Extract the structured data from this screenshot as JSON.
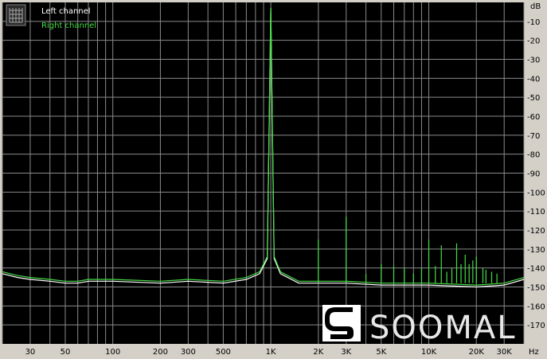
{
  "chart_data": {
    "type": "line",
    "title": "",
    "xlabel": "",
    "ylabel": "",
    "x_unit": "Hz",
    "y_unit": "dB",
    "x_scale": "log",
    "xlim": [
      20,
      40000
    ],
    "ylim": [
      -180,
      0
    ],
    "grid": true,
    "legend_placement": "top-left",
    "x_ticks": [
      {
        "value": 30,
        "label": "30"
      },
      {
        "value": 50,
        "label": "50"
      },
      {
        "value": 100,
        "label": "100"
      },
      {
        "value": 200,
        "label": "200"
      },
      {
        "value": 300,
        "label": "300"
      },
      {
        "value": 500,
        "label": "500"
      },
      {
        "value": 1000,
        "label": "1K"
      },
      {
        "value": 2000,
        "label": "2K"
      },
      {
        "value": 3000,
        "label": "3K"
      },
      {
        "value": 5000,
        "label": "5K"
      },
      {
        "value": 10000,
        "label": "10K"
      },
      {
        "value": 20000,
        "label": "20K"
      },
      {
        "value": 30000,
        "label": "30K"
      }
    ],
    "y_ticks": [
      -10,
      -20,
      -30,
      -40,
      -50,
      -60,
      -70,
      -80,
      -90,
      -100,
      -110,
      -120,
      -130,
      -140,
      -150,
      -160,
      -170
    ],
    "series": [
      {
        "name": "Left channel",
        "color": "#ffffff",
        "points": [
          [
            20,
            -143
          ],
          [
            25,
            -145
          ],
          [
            30,
            -146
          ],
          [
            40,
            -147
          ],
          [
            50,
            -148
          ],
          [
            60,
            -148
          ],
          [
            70,
            -147
          ],
          [
            100,
            -147
          ],
          [
            200,
            -148
          ],
          [
            300,
            -147
          ],
          [
            500,
            -148
          ],
          [
            700,
            -146
          ],
          [
            850,
            -143
          ],
          [
            950,
            -135
          ],
          [
            1000,
            -3
          ],
          [
            1050,
            -135
          ],
          [
            1150,
            -143
          ],
          [
            1500,
            -148
          ],
          [
            2000,
            -148
          ],
          [
            3000,
            -148
          ],
          [
            5000,
            -149
          ],
          [
            10000,
            -149
          ],
          [
            20000,
            -150
          ],
          [
            30000,
            -149
          ],
          [
            40000,
            -146
          ]
        ]
      },
      {
        "name": "Right channel",
        "color": "#44dd44",
        "points": [
          [
            20,
            -142
          ],
          [
            25,
            -144
          ],
          [
            30,
            -145
          ],
          [
            40,
            -146
          ],
          [
            50,
            -147
          ],
          [
            60,
            -147
          ],
          [
            70,
            -146
          ],
          [
            100,
            -146
          ],
          [
            200,
            -147
          ],
          [
            300,
            -146
          ],
          [
            500,
            -147
          ],
          [
            700,
            -145
          ],
          [
            850,
            -142
          ],
          [
            950,
            -134
          ],
          [
            1000,
            -3
          ],
          [
            1050,
            -134
          ],
          [
            1150,
            -142
          ],
          [
            1500,
            -147
          ],
          [
            2000,
            -147
          ],
          [
            3000,
            -147
          ],
          [
            5000,
            -148
          ],
          [
            10000,
            -148
          ],
          [
            20000,
            -149
          ],
          [
            30000,
            -148
          ],
          [
            40000,
            -145
          ]
        ],
        "spikes": [
          [
            2000,
            -125
          ],
          [
            3000,
            -113
          ],
          [
            4000,
            -143
          ],
          [
            5000,
            -138
          ],
          [
            6000,
            -139
          ],
          [
            7000,
            -140
          ],
          [
            8000,
            -143
          ],
          [
            9000,
            -140
          ],
          [
            10000,
            -125
          ],
          [
            11000,
            -139
          ],
          [
            12000,
            -128
          ],
          [
            13000,
            -142
          ],
          [
            14000,
            -140
          ],
          [
            15000,
            -127
          ],
          [
            16000,
            -138
          ],
          [
            17000,
            -133
          ],
          [
            18000,
            -138
          ],
          [
            19000,
            -136
          ],
          [
            20000,
            -134
          ],
          [
            22000,
            -140
          ],
          [
            23000,
            -141
          ],
          [
            25000,
            -142
          ],
          [
            27000,
            -143
          ]
        ]
      }
    ]
  },
  "logo": {
    "text": "SOOMAL"
  }
}
